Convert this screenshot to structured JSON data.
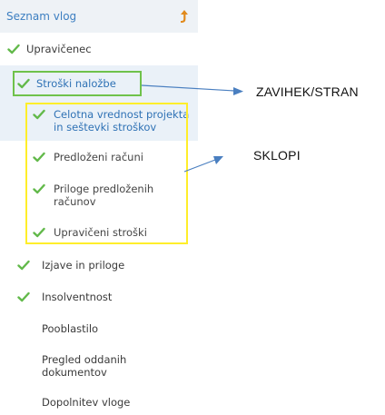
{
  "sidebar": {
    "title": "Seznam vlog",
    "items": [
      {
        "label": "Upravičenec",
        "checked": true
      },
      {
        "label": "Stroški naložbe",
        "checked": true
      },
      {
        "label": "Celotna vrednost projekta",
        "label2": "in seštevki stroškov",
        "checked": true
      },
      {
        "label": "Predloženi računi",
        "checked": true
      },
      {
        "label": "Priloge predloženih",
        "label2": "računov",
        "checked": true
      },
      {
        "label": "Upravičeni stroški",
        "checked": true
      },
      {
        "label": "Izjave in priloge",
        "checked": true
      },
      {
        "label": "Insolventnost",
        "checked": true
      },
      {
        "label": "Pooblastilo",
        "checked": false
      },
      {
        "label": "Pregled oddanih",
        "label2": "dokumentov",
        "checked": false
      },
      {
        "label": "Dopolnitev vloge",
        "checked": false
      }
    ]
  },
  "annotations": {
    "tab_label": "ZAVIHEK/STRAN",
    "section_label": "SKLOPI"
  },
  "colors": {
    "accent_blue": "#2f72b5",
    "check_green": "#62b94a",
    "highlight_green": "#6fc24b",
    "highlight_yellow": "#ffee2a",
    "arrow_blue": "#4a7fc0"
  },
  "icons": {
    "check": "check-icon",
    "sort": "sort-arrow-icon"
  }
}
